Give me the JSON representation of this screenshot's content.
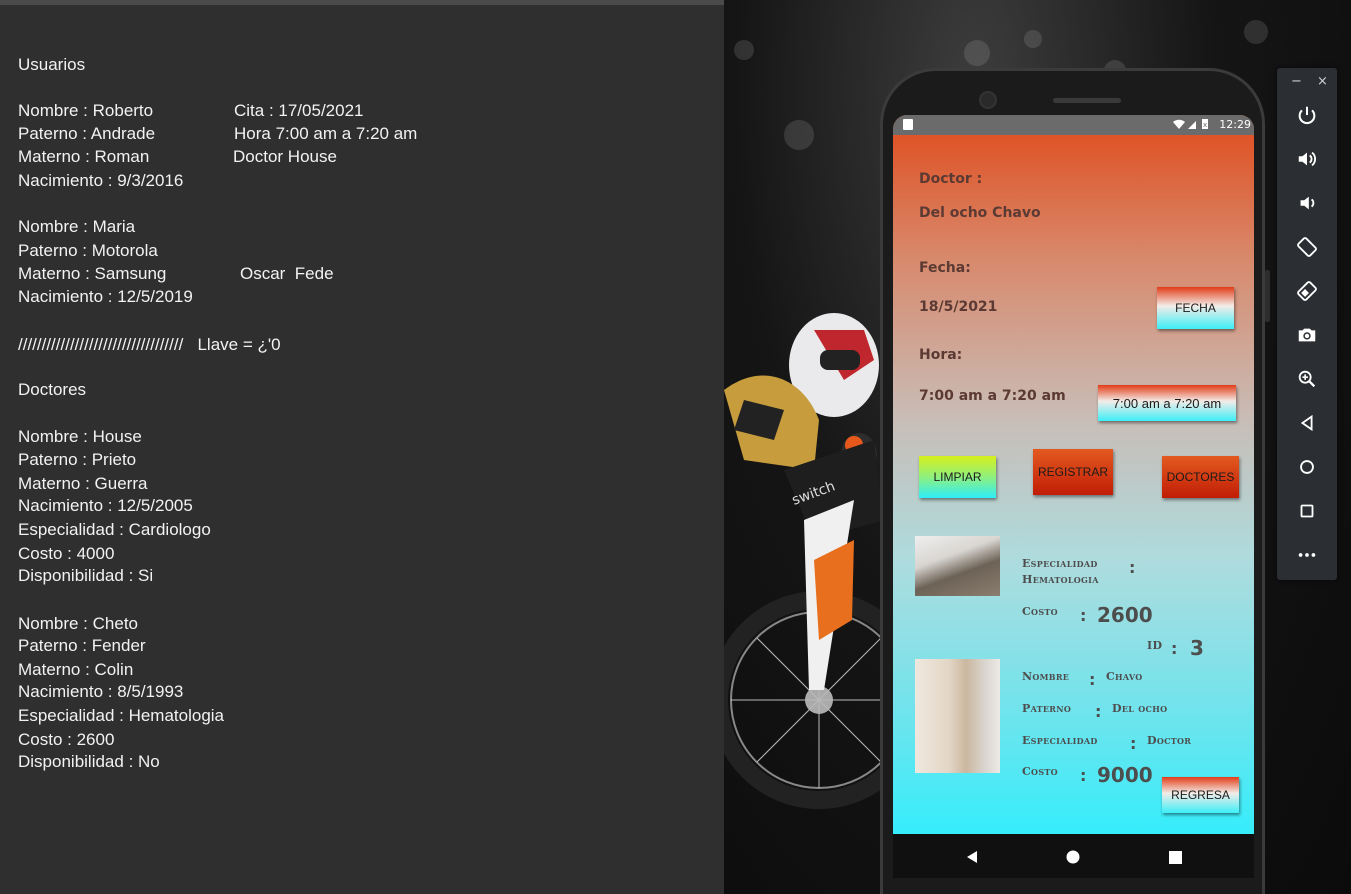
{
  "notes": {
    "heading_users": "Usuarios",
    "users": [
      {
        "nombre": "Nombre : Roberto",
        "paterno": "Paterno : Andrade",
        "materno": "Materno : Roman",
        "nacimiento": "Nacimiento : 9/3/2016",
        "cita": "Cita : 17/05/2021",
        "hora": "Hora 7:00 am a 7:20 am",
        "doctor": "Doctor House"
      },
      {
        "nombre": "Nombre : Maria",
        "paterno": "Paterno : Motorola",
        "materno": "Materno : Samsung",
        "nacimiento": "Nacimiento : 12/5/2019",
        "extra": "Oscar  Fede"
      }
    ],
    "separator": "///////////////////////////////////   Llave = ¿'0",
    "heading_doctors": "Doctores",
    "doctors": [
      {
        "nombre": "Nombre : House",
        "paterno": "Paterno : Prieto",
        "materno": "Materno : Guerra",
        "nacimiento": "Nacimiento : 12/5/2005",
        "especialidad": "Especialidad : Cardiologo",
        "costo": "Costo : 4000",
        "disponibilidad": "Disponibilidad : Si"
      },
      {
        "nombre": "Nombre : Cheto",
        "paterno": "Paterno : Fender",
        "materno": "Materno : Colin",
        "nacimiento": "Nacimiento : 8/5/1993",
        "especialidad": "Especialidad : Hematologia",
        "costo": "Costo : 2600",
        "disponibilidad": "Disponibilidad : No"
      }
    ]
  },
  "phone": {
    "status_time": "12:29",
    "doctor_label": "Doctor :",
    "doctor_value": "Del ocho Chavo",
    "fecha_label": "Fecha:",
    "fecha_value": "18/5/2021",
    "fecha_button": "FECHA",
    "hora_label": "Hora:",
    "hora_value": "7:00 am a 7:20 am",
    "hora_button": "7:00 am a 7:20 am",
    "btn_limpiar": "LIMPIAR",
    "btn_registrar": "REGISTRAR",
    "btn_doctores": "DOCTORES",
    "btn_regresa": "REGRESA",
    "card1": {
      "especialidad_label": "Especialidad",
      "especialidad_value": "Hematologia",
      "costo_label": "Costo",
      "costo_value": "2600",
      "id_label": "ID",
      "id_value": "3"
    },
    "card2": {
      "nombre_label": "Nombre",
      "nombre_value": "Chavo",
      "paterno_label": "Paterno",
      "paterno_value": "Del ocho",
      "especialidad_label": "Especialidad",
      "especialidad_value": "Doctor",
      "costo_label": "Costo",
      "costo_value": "9000"
    },
    "colon": ":"
  },
  "emulator": {
    "minimize": "−",
    "close": "×",
    "tools": [
      "power-icon",
      "volume-up-icon",
      "volume-down-icon",
      "rotate-left-icon",
      "rotate-right-icon",
      "camera-icon",
      "zoom-icon",
      "back-icon",
      "home-icon",
      "overview-icon",
      "more-icon"
    ]
  },
  "colors": {
    "editor_bg": "#2f2f2f",
    "screen_top": "#e04b1c",
    "screen_bottom": "#36edfb",
    "button_red": "#c11d05",
    "button_green": "#8ff07e"
  }
}
